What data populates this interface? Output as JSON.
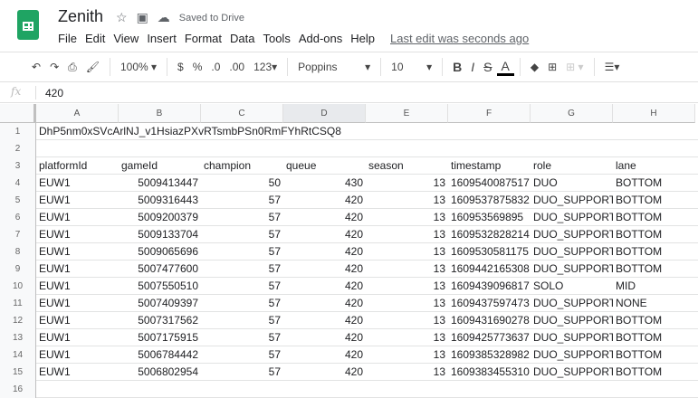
{
  "app": {
    "title": "Zenith",
    "saved": "Saved to Drive",
    "last_edit": "Last edit was seconds ago"
  },
  "menu": [
    "File",
    "Edit",
    "View",
    "Insert",
    "Format",
    "Data",
    "Tools",
    "Add-ons",
    "Help"
  ],
  "toolbar": {
    "zoom": "100%",
    "currency": "$",
    "percent": "%",
    "dec_less": ".0",
    "dec_more": ".00",
    "format": "123",
    "font": "Poppins",
    "size": "10",
    "bold": "B",
    "italic": "I",
    "strike": "S",
    "color": "A"
  },
  "formula": {
    "fx": "fx",
    "value": "420"
  },
  "columns": [
    "A",
    "B",
    "C",
    "D",
    "E",
    "F",
    "G",
    "H"
  ],
  "row1": "DhP5nm0xSVcArlNJ_v1HsiazPXvRTsmbPSn0RmFYhRtCSQ8",
  "headers": [
    "platformId",
    "gameId",
    "champion",
    "queue",
    "season",
    "timestamp",
    "role",
    "lane"
  ],
  "rows": [
    [
      "EUW1",
      "5009413447",
      "50",
      "430",
      "13",
      "1609540087517",
      "DUO",
      "BOTTOM"
    ],
    [
      "EUW1",
      "5009316443",
      "57",
      "420",
      "13",
      "1609537875832",
      "DUO_SUPPORT",
      "BOTTOM"
    ],
    [
      "EUW1",
      "5009200379",
      "57",
      "420",
      "13",
      "160953569895",
      "DUO_SUPPORT",
      "BOTTOM"
    ],
    [
      "EUW1",
      "5009133704",
      "57",
      "420",
      "13",
      "1609532828214",
      "DUO_SUPPORT",
      "BOTTOM"
    ],
    [
      "EUW1",
      "5009065696",
      "57",
      "420",
      "13",
      "1609530581175",
      "DUO_SUPPORT",
      "BOTTOM"
    ],
    [
      "EUW1",
      "5007477600",
      "57",
      "420",
      "13",
      "1609442165308",
      "DUO_SUPPORT",
      "BOTTOM"
    ],
    [
      "EUW1",
      "5007550510",
      "57",
      "420",
      "13",
      "1609439096817",
      "SOLO",
      "MID"
    ],
    [
      "EUW1",
      "5007409397",
      "57",
      "420",
      "13",
      "1609437597473",
      "DUO_SUPPORT",
      "NONE"
    ],
    [
      "EUW1",
      "5007317562",
      "57",
      "420",
      "13",
      "1609431690278",
      "DUO_SUPPORT",
      "BOTTOM"
    ],
    [
      "EUW1",
      "5007175915",
      "57",
      "420",
      "13",
      "1609425773637",
      "DUO_SUPPORT",
      "BOTTOM"
    ],
    [
      "EUW1",
      "5006784442",
      "57",
      "420",
      "13",
      "1609385328982",
      "DUO_SUPPORT",
      "BOTTOM"
    ],
    [
      "EUW1",
      "5006802954",
      "57",
      "420",
      "13",
      "1609383455310",
      "DUO_SUPPORT",
      "BOTTOM"
    ]
  ]
}
